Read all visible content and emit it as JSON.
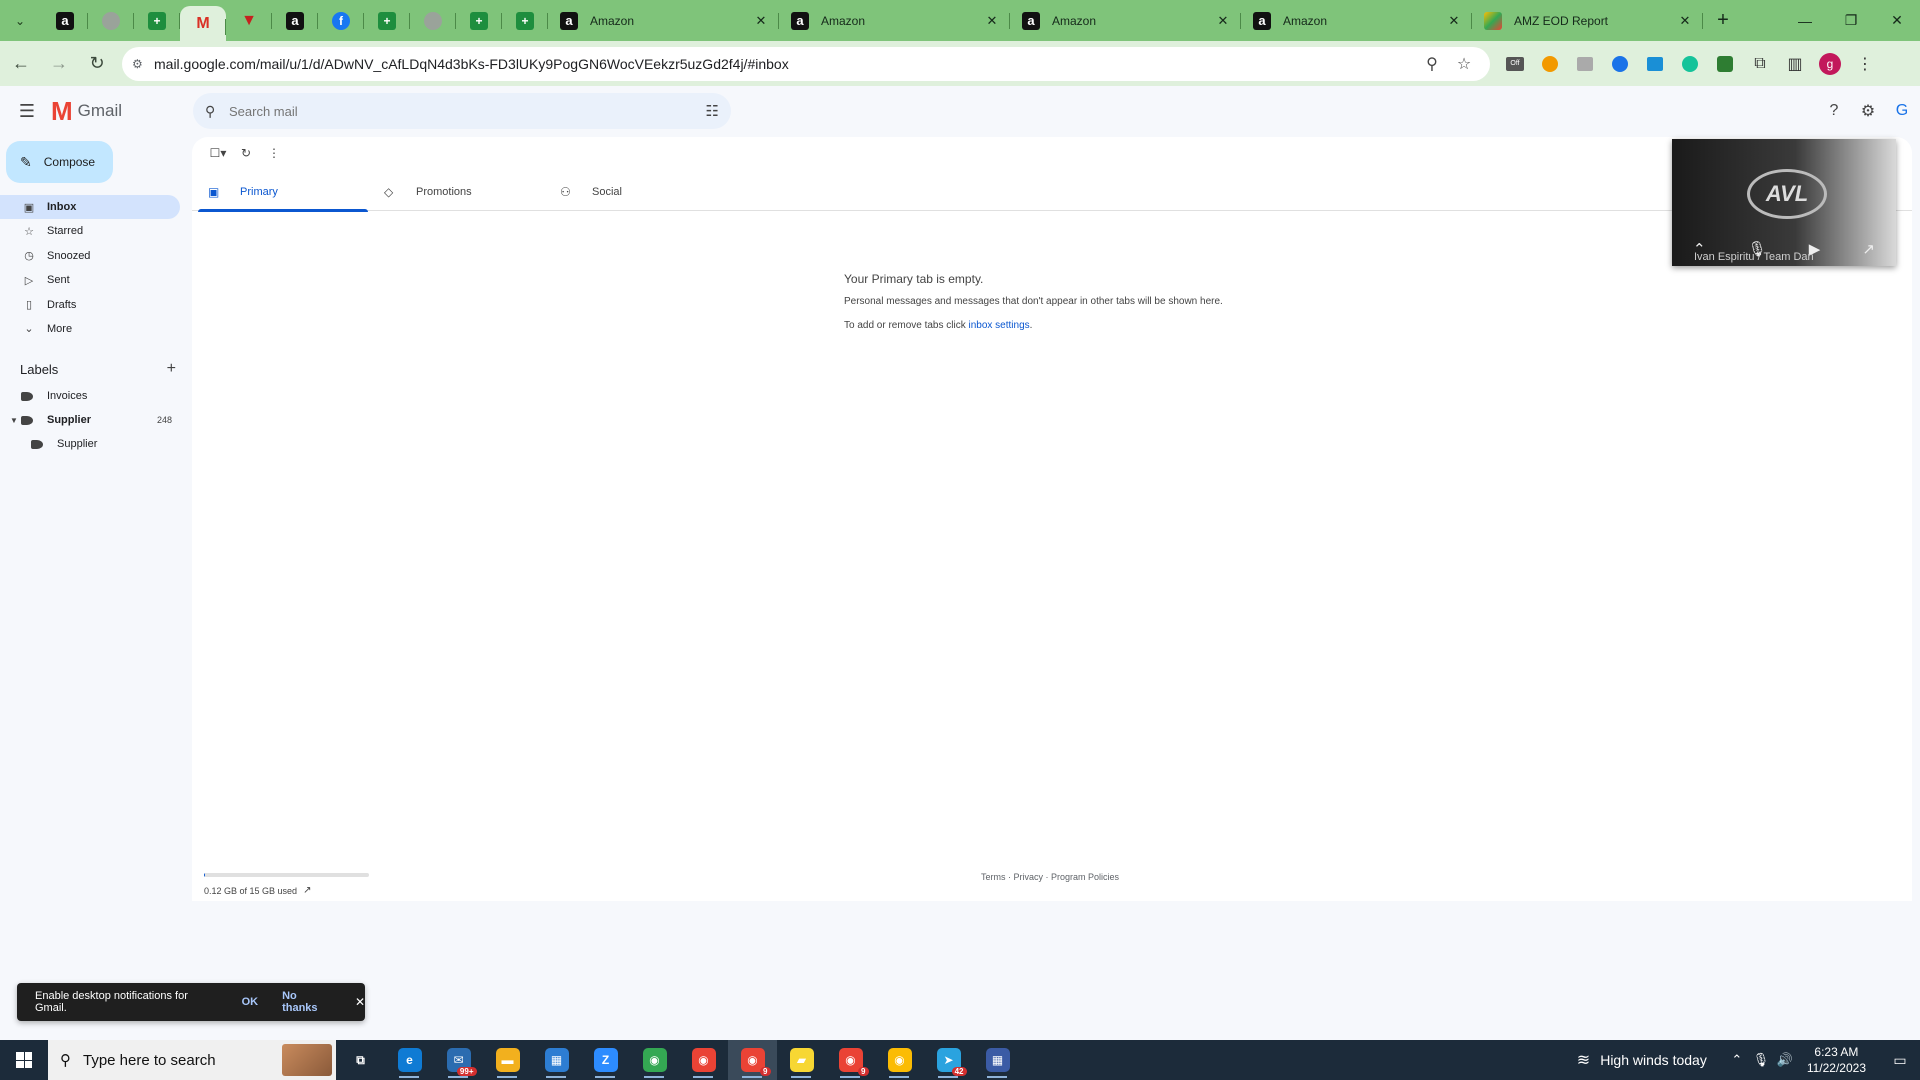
{
  "browser": {
    "pinned_tabs": [
      {
        "icon": "amazon-icon",
        "glyph": "a",
        "kind": "amz"
      },
      {
        "icon": "globe-icon",
        "glyph": "",
        "kind": "grey"
      },
      {
        "icon": "sheets-icon",
        "glyph": "+",
        "kind": "sheet"
      },
      {
        "icon": "gmail-icon",
        "glyph": "M",
        "kind": "gm",
        "active": true
      },
      {
        "icon": "red-app-icon",
        "glyph": "▼",
        "kind": "red"
      },
      {
        "icon": "amazon-icon",
        "glyph": "a",
        "kind": "amz"
      },
      {
        "icon": "facebook-icon",
        "glyph": "f",
        "kind": "fb"
      },
      {
        "icon": "sheets-icon",
        "glyph": "+",
        "kind": "sheet"
      },
      {
        "icon": "globe-icon",
        "glyph": "",
        "kind": "grey"
      },
      {
        "icon": "sheets-icon",
        "glyph": "+",
        "kind": "sheet"
      },
      {
        "icon": "sheets-icon",
        "glyph": "+",
        "kind": "sheet"
      }
    ],
    "tabs": [
      {
        "title": "Amazon",
        "kind": "amz",
        "glyph": "a"
      },
      {
        "title": "Amazon",
        "kind": "amz",
        "glyph": "a"
      },
      {
        "title": "Amazon",
        "kind": "amz",
        "glyph": "a"
      },
      {
        "title": "Amazon",
        "kind": "amz",
        "glyph": "a"
      },
      {
        "title": "AMZ EOD Report",
        "kind": "amzeod",
        "glyph": ""
      }
    ],
    "url": "mail.google.com/mail/u/1/d/ADwNV_cAfLDqN4d3bKs-FD3lUKy9PogGN6WocVEekzr5uzGd2f4j/#inbox",
    "profile_initial": "g"
  },
  "gmail": {
    "logo_text": "Gmail",
    "search_placeholder": "Search mail",
    "compose_label": "Compose",
    "nav": [
      {
        "id": "inbox",
        "label": "Inbox",
        "icon": "inbox-icon",
        "glyph": "▣",
        "active": true
      },
      {
        "id": "starred",
        "label": "Starred",
        "icon": "star-icon",
        "glyph": "☆"
      },
      {
        "id": "snoozed",
        "label": "Snoozed",
        "icon": "clock-icon",
        "glyph": "◷"
      },
      {
        "id": "sent",
        "label": "Sent",
        "icon": "send-icon",
        "glyph": "▷"
      },
      {
        "id": "drafts",
        "label": "Drafts",
        "icon": "draft-icon",
        "glyph": "▯"
      },
      {
        "id": "more",
        "label": "More",
        "icon": "chevron-down-icon",
        "glyph": "⌄"
      }
    ],
    "labels_heading": "Labels",
    "labels": [
      {
        "label": "Invoices",
        "count": "",
        "bold": false,
        "sub": false,
        "caret": false
      },
      {
        "label": "Supplier",
        "count": "248",
        "bold": true,
        "sub": false,
        "caret": true
      },
      {
        "label": "Supplier",
        "count": "",
        "bold": false,
        "sub": true,
        "caret": false
      }
    ],
    "category_tabs": [
      {
        "label": "Primary",
        "icon": "inbox-icon",
        "glyph": "▣",
        "active": true
      },
      {
        "label": "Promotions",
        "icon": "tag-icon",
        "glyph": "◇"
      },
      {
        "label": "Social",
        "icon": "people-icon",
        "glyph": "⚇"
      }
    ],
    "empty": {
      "title": "Your Primary tab is empty.",
      "desc": "Personal messages and messages that don't appear in other tabs will be shown here.",
      "settings_prefix": "To add or remove tabs click ",
      "settings_link": "inbox settings",
      "settings_suffix": "."
    },
    "storage": {
      "text": "0.12 GB of 15 GB used",
      "used_fraction": 0.008
    },
    "footer": "Terms · Privacy · Program Policies",
    "pip": {
      "name": "Ivan Espiritu / Team Dan",
      "logo": "AVL"
    },
    "toast": {
      "text": "Enable desktop notifications for Gmail.",
      "ok": "OK",
      "no": "No thanks"
    }
  },
  "taskbar": {
    "search_placeholder": "Type here to search",
    "weather": "High winds today",
    "time": "6:23 AM",
    "date": "11/22/2023",
    "apps": [
      {
        "name": "task-view-icon",
        "glyph": "⧉",
        "bg": "transparent"
      },
      {
        "name": "edge-icon",
        "glyph": "e",
        "bg": "#0f7bd4"
      },
      {
        "name": "mail-app-icon",
        "glyph": "✉",
        "bg": "#2b6cb0",
        "badge": "99+"
      },
      {
        "name": "file-explorer-icon",
        "glyph": "▬",
        "bg": "#f2b01e"
      },
      {
        "name": "store-icon",
        "glyph": "▦",
        "bg": "#2d7dd2"
      },
      {
        "name": "zoom-icon",
        "glyph": "Z",
        "bg": "#2d8cff"
      },
      {
        "name": "chrome-icon",
        "glyph": "◉",
        "bg": "#34a853"
      },
      {
        "name": "chrome-icon",
        "glyph": "◉",
        "bg": "#ea4335"
      },
      {
        "name": "chrome-icon",
        "glyph": "◉",
        "bg": "#ea4335",
        "badge": "9",
        "hl": true
      },
      {
        "name": "sticky-notes-icon",
        "glyph": "▰",
        "bg": "#f7d733"
      },
      {
        "name": "chrome-icon",
        "glyph": "◉",
        "bg": "#ea4335",
        "badge": "9"
      },
      {
        "name": "chrome-icon",
        "glyph": "◉",
        "bg": "#fbbc04"
      },
      {
        "name": "telegram-icon",
        "glyph": "➤",
        "bg": "#2aa3df",
        "badge": "42"
      },
      {
        "name": "calculator-icon",
        "glyph": "▦",
        "bg": "#3b5ba5"
      }
    ]
  }
}
